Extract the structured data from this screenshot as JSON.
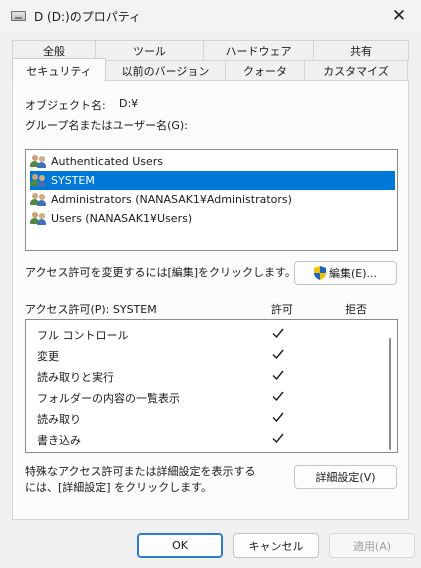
{
  "window": {
    "title": "D (D:)のプロパティ",
    "close_glyph": "✕"
  },
  "tabs_top": [
    {
      "label": "全般"
    },
    {
      "label": "ツール"
    },
    {
      "label": "ハードウェア"
    },
    {
      "label": "共有"
    }
  ],
  "tabs_bottom": [
    {
      "label": "セキュリティ",
      "active": true
    },
    {
      "label": "以前のバージョン"
    },
    {
      "label": "クォータ"
    },
    {
      "label": "カスタマイズ"
    }
  ],
  "security": {
    "object_name_label": "オブジェクト名:",
    "object_name_value": "D:¥",
    "group_label": "グループ名またはユーザー名(G):",
    "users": [
      {
        "name": "Authenticated Users",
        "selected": false
      },
      {
        "name": "SYSTEM",
        "selected": true
      },
      {
        "name": "Administrators (NANASAK1¥Administrators)",
        "selected": false
      },
      {
        "name": "Users (NANASAK1¥Users)",
        "selected": false
      }
    ],
    "change_hint": "アクセス許可を変更するには[編集]をクリックします。",
    "edit_button": "編集(E)...",
    "perm_label": "アクセス許可(P): SYSTEM",
    "allow_header": "許可",
    "deny_header": "拒否",
    "permissions": [
      {
        "name": "フル コントロール",
        "allow": true,
        "deny": false
      },
      {
        "name": "変更",
        "allow": true,
        "deny": false
      },
      {
        "name": "読み取りと実行",
        "allow": true,
        "deny": false
      },
      {
        "name": "フォルダーの内容の一覧表示",
        "allow": true,
        "deny": false
      },
      {
        "name": "読み取り",
        "allow": true,
        "deny": false
      },
      {
        "name": "書き込み",
        "allow": true,
        "deny": false
      }
    ],
    "advanced_hint_line1": "特殊なアクセス許可または詳細設定を表示する",
    "advanced_hint_line2": "には、[詳細設定] をクリックします。",
    "advanced_button": "詳細設定(V)"
  },
  "footer": {
    "ok": "OK",
    "cancel": "キャンセル",
    "apply": "適用(A)"
  }
}
